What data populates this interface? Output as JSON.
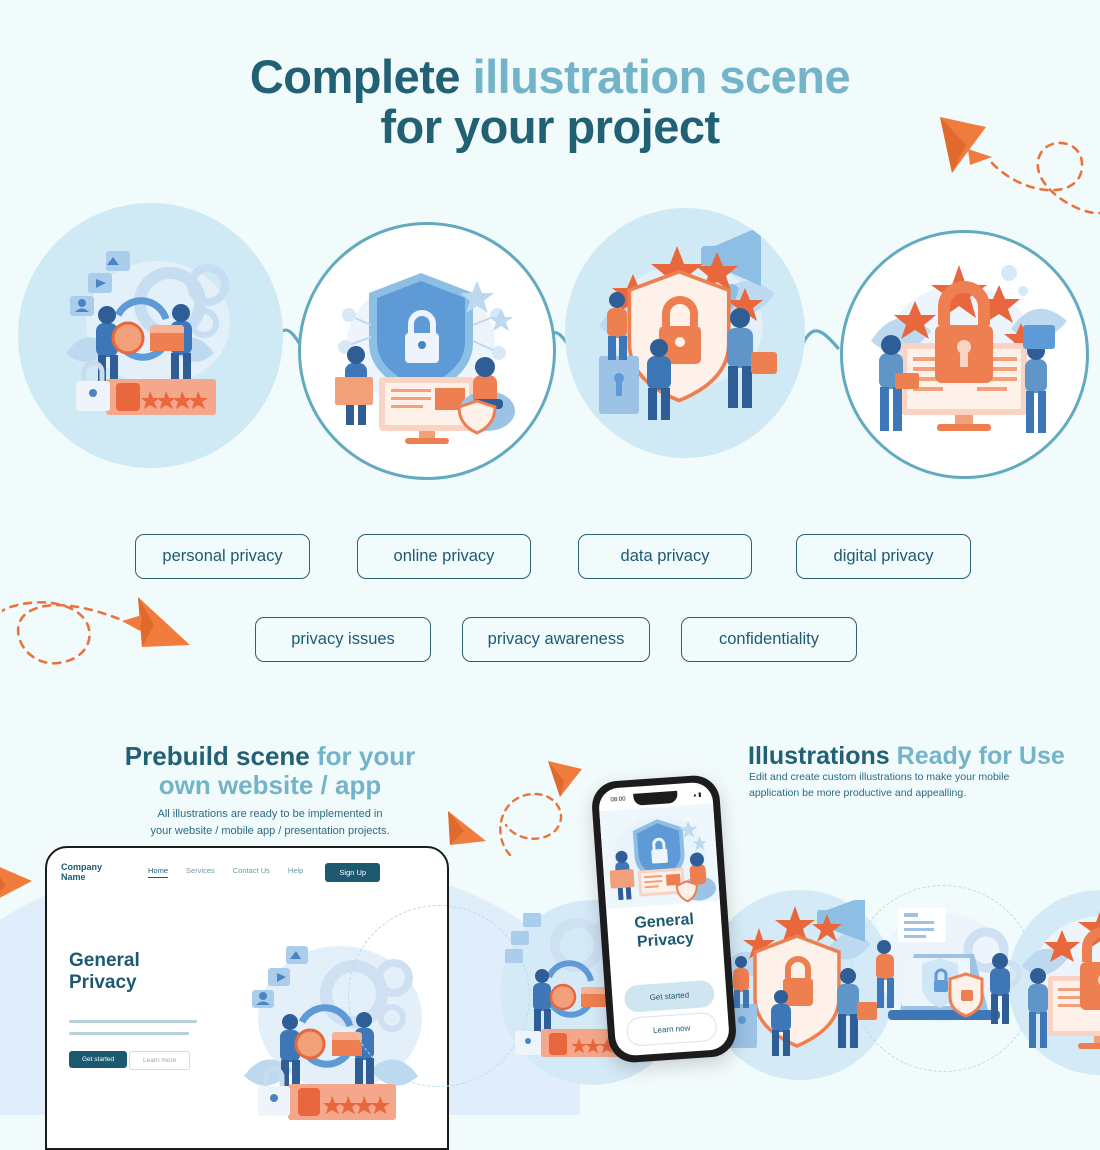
{
  "page": {
    "background_color": "#f2fbfc",
    "accent_dark": "#226074",
    "accent_light": "#73b4c9",
    "accent_orange": "#e8743b"
  },
  "header": {
    "title_line1_dark": "Complete",
    "title_line1_light": "illustration scene",
    "title_line2": "for your project"
  },
  "scenes": [
    {
      "name": "data-sharing-scene",
      "style": "filled"
    },
    {
      "name": "shield-lock-scene",
      "style": "outlined"
    },
    {
      "name": "security-rating-scene",
      "style": "filled"
    },
    {
      "name": "desktop-lock-scene",
      "style": "outlined"
    }
  ],
  "tags": {
    "row1": [
      "personal privacy",
      "online privacy",
      "data privacy",
      "digital privacy"
    ],
    "row2": [
      "privacy issues",
      "privacy awareness",
      "confidentiality"
    ]
  },
  "prebuild": {
    "heading_dark": "Prebuild scene",
    "heading_light": "for your",
    "heading_light2": "own website / app",
    "sub_line1": "All illustrations are ready to be implemented in",
    "sub_line2": "your website / mobile app / presentation projects."
  },
  "ready": {
    "heading_dark": "Illustrations",
    "heading_light": "Ready for Use",
    "sub_line1": "Edit and create custom illustrations to make your mobile",
    "sub_line2": "application be more productive and appealling."
  },
  "website_mock": {
    "logo_line1": "Company",
    "logo_line2": "Name",
    "nav": [
      "Home",
      "Services",
      "Contact Us",
      "Help"
    ],
    "signup_label": "Sign Up",
    "hero_title_line1": "General",
    "hero_title_line2": "Privacy",
    "cta_primary": "Get started",
    "cta_secondary": "Learn more"
  },
  "phone_mock": {
    "status_time": "08:00",
    "status_icons": "signal-wifi-battery",
    "title_line1": "General",
    "title_line2": "Privacy",
    "cta_primary": "Get started",
    "cta_secondary": "Learn now"
  }
}
